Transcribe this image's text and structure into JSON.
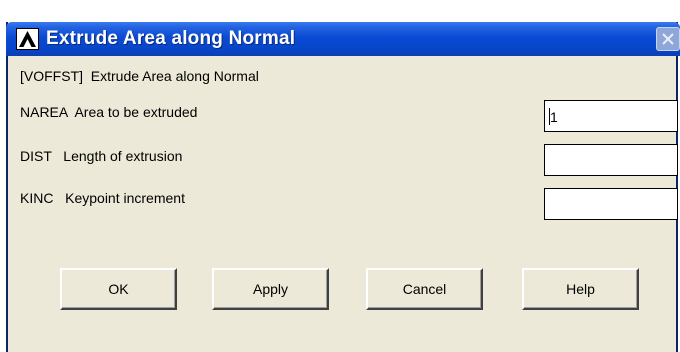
{
  "window": {
    "title": "Extrude Area along Normal",
    "icon": "ansys-logo-icon",
    "close": "close-icon"
  },
  "command_label": "[VOFFST]  Extrude Area along Normal",
  "fields": [
    {
      "name": "NAREA",
      "label": "NAREA  Area to be extruded",
      "value": "1"
    },
    {
      "name": "DIST",
      "label": "DIST   Length of extrusion",
      "value": ""
    },
    {
      "name": "KINC",
      "label": "KINC   Keypoint increment",
      "value": ""
    }
  ],
  "buttons": {
    "ok": "OK",
    "apply": "Apply",
    "cancel": "Cancel",
    "help": "Help"
  },
  "colors": {
    "titlebar": "#0a4ad4",
    "dialog_bg": "#ece9d8"
  }
}
